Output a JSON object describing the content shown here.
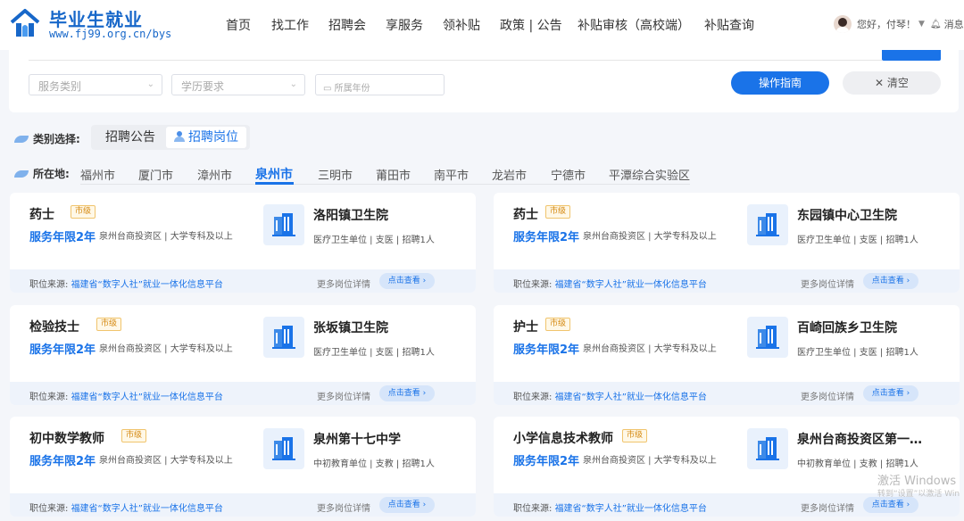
{
  "header": {
    "site_title": "毕业生就业",
    "site_url": "www.fj99.org.cn/bys",
    "nav": [
      "首页",
      "找工作",
      "招聘会",
      "享服务",
      "领补贴",
      "政策 | 公告",
      "补贴审核（高校端）",
      "补贴查询"
    ],
    "greeting": "您好，付琴！",
    "messages_label": "消息"
  },
  "filters": {
    "service_type_placeholder": "服务类别",
    "education_placeholder": "学历要求",
    "year_placeholder": "所属年份",
    "guide_button": "操作指南",
    "clear_button": "清空"
  },
  "category": {
    "label": "类别选择:",
    "options": [
      "招聘公告",
      "招聘岗位"
    ],
    "selected": "招聘岗位"
  },
  "location": {
    "label": "所在地:",
    "cities": [
      "福州市",
      "厦门市",
      "漳州市",
      "泉州市",
      "三明市",
      "莆田市",
      "南平市",
      "龙岩市",
      "宁德市",
      "平潭综合实验区"
    ],
    "selected": "泉州市"
  },
  "jobs": [
    {
      "title": "药士",
      "level": "市级",
      "years": "服务年限2年",
      "info": "泉州台商投资区 | 大学专科及以上",
      "org": "洛阳镇卫生院",
      "org_info": "医疗卫生单位 | 支医 | 招聘1人",
      "source_label": "职位来源:",
      "source": "福建省“数字人社”就业一体化信息平台",
      "more": "更多岗位详情",
      "view": "点击查看 ›"
    },
    {
      "title": "药士",
      "level": "市级",
      "years": "服务年限2年",
      "info": "泉州台商投资区 | 大学专科及以上",
      "org": "东园镇中心卫生院",
      "org_info": "医疗卫生单位 | 支医 | 招聘1人",
      "source_label": "职位来源:",
      "source": "福建省“数字人社”就业一体化信息平台",
      "more": "更多岗位详情",
      "view": "点击查看 ›"
    },
    {
      "title": "检验技士",
      "level": "市级",
      "years": "服务年限2年",
      "info": "泉州台商投资区 | 大学专科及以上",
      "org": "张坂镇卫生院",
      "org_info": "医疗卫生单位 | 支医 | 招聘1人",
      "source_label": "职位来源:",
      "source": "福建省“数字人社”就业一体化信息平台",
      "more": "更多岗位详情",
      "view": "点击查看 ›"
    },
    {
      "title": "护士",
      "level": "市级",
      "years": "服务年限2年",
      "info": "泉州台商投资区 | 大学专科及以上",
      "org": "百崎回族乡卫生院",
      "org_info": "医疗卫生单位 | 支医 | 招聘1人",
      "source_label": "职位来源:",
      "source": "福建省“数字人社”就业一体化信息平台",
      "more": "更多岗位详情",
      "view": "点击查看 ›"
    },
    {
      "title": "初中数学教师",
      "level": "市级",
      "years": "服务年限2年",
      "info": "泉州台商投资区 | 大学专科及以上",
      "org": "泉州第十七中学",
      "org_info": "中初教育单位 | 支教 | 招聘1人",
      "source_label": "职位来源:",
      "source": "福建省“数字人社”就业一体化信息平台",
      "more": "更多岗位详情",
      "view": "点击查看 ›"
    },
    {
      "title": "小学信息技术教师",
      "level": "市级",
      "years": "服务年限2年",
      "info": "泉州台商投资区 | 大学专科及以上",
      "org": "泉州台商投资区第一…",
      "org_info": "中初教育单位 | 支教 | 招聘1人",
      "source_label": "职位来源:",
      "source": "福建省“数字人社”就业一体化信息平台",
      "more": "更多岗位详情",
      "view": "点击查看 ›"
    }
  ],
  "watermark": {
    "line1": "激活 Windows",
    "line2": "转到“设置”以激活 Win"
  },
  "colors": {
    "brand": "#1a73e8",
    "badge": "#d4880f",
    "background": "#f4f6fa"
  }
}
